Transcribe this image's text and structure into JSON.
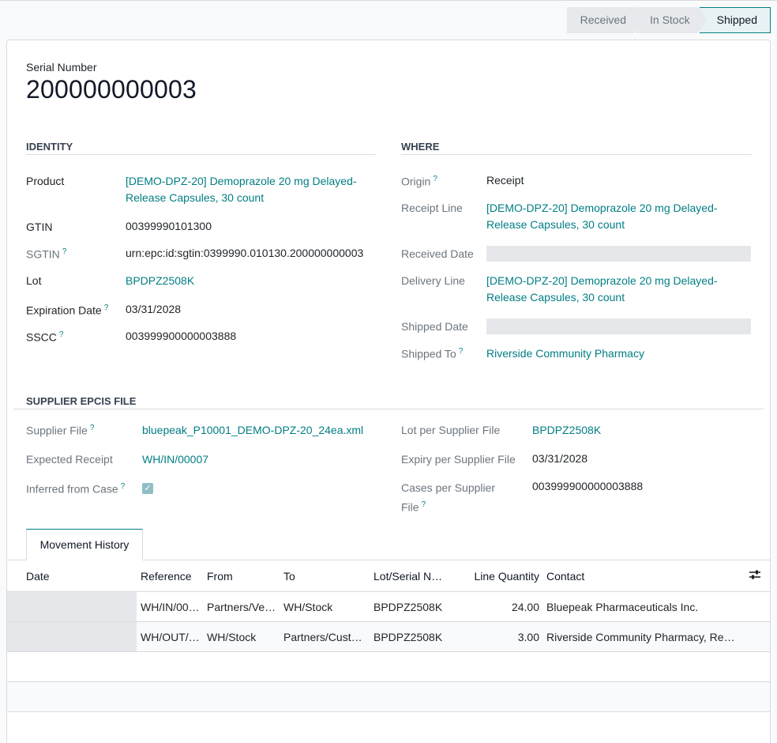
{
  "statusbar": {
    "stages": [
      {
        "label": "Received",
        "current": false
      },
      {
        "label": "In Stock",
        "current": false
      },
      {
        "label": "Shipped",
        "current": true
      }
    ]
  },
  "record": {
    "serial_label": "Serial Number",
    "serial_value": "200000000003"
  },
  "identity": {
    "heading": "IDENTITY",
    "product_label": "Product",
    "product_value_1": "[DEMO-DPZ-20] Demoprazole 20 mg Delayed-",
    "product_value_2": "Release Capsules, 30 count",
    "gtin_label": "GTIN",
    "gtin_value": "00399990101300",
    "sgtin_label": "SGTIN",
    "sgtin_value": "urn:epc:id:sgtin:0399990.010130.200000000003",
    "lot_label": "Lot",
    "lot_value": "BPDPZ2508K",
    "expiration_label": "Expiration Date",
    "expiration_value": "03/31/2028",
    "sscc_label": "SSCC",
    "sscc_value": "003999900000003888"
  },
  "where": {
    "heading": "WHERE",
    "origin_label": "Origin",
    "origin_value": "Receipt",
    "receipt_line_label": "Receipt Line",
    "receipt_line_value_1": "[DEMO-DPZ-20] Demoprazole 20 mg Delayed-",
    "receipt_line_value_2": "Release Capsules, 30 count",
    "received_date_label": "Received Date",
    "delivery_line_label": "Delivery Line",
    "delivery_line_value_1": "[DEMO-DPZ-20] Demoprazole 20 mg Delayed-",
    "delivery_line_value_2": "Release Capsules, 30 count",
    "shipped_date_label": "Shipped Date",
    "shipped_to_label": "Shipped To",
    "shipped_to_value": "Riverside Community Pharmacy"
  },
  "supplier": {
    "heading": "SUPPLIER EPCIS FILE",
    "file_label": "Supplier File",
    "file_value": "bluepeak_P10001_DEMO-DPZ-20_24ea.xml",
    "expected_label": "Expected Receipt",
    "expected_value": "WH/IN/00007",
    "inferred_label": "Inferred from Case",
    "lot_label": "Lot per Supplier File",
    "lot_value": "BPDPZ2508K",
    "expiry_label": "Expiry per Supplier File",
    "expiry_value": "03/31/2028",
    "cases_label_1": "Cases per Supplier",
    "cases_label_2": "File",
    "cases_value": "003999900000003888"
  },
  "tabs": {
    "movement_history": "Movement History"
  },
  "table": {
    "headers": {
      "date": "Date",
      "reference": "Reference",
      "from": "From",
      "to": "To",
      "lot": "Lot/Serial N…",
      "qty": "Line Quantity",
      "contact": "Contact"
    },
    "rows": [
      {
        "date": "",
        "reference": "WH/IN/00…",
        "from": "Partners/Ve…",
        "to": "WH/Stock",
        "lot": "BPDPZ2508K",
        "qty": "24.00",
        "contact": "Bluepeak Pharmaceuticals Inc."
      },
      {
        "date": "",
        "reference": "WH/OUT/…",
        "from": "WH/Stock",
        "to": "Partners/Cust…",
        "lot": "BPDPZ2508K",
        "qty": "3.00",
        "contact": "Riverside Community Pharmacy, Rec…"
      }
    ]
  },
  "help_marker": "?",
  "icons": {
    "checkbox": "check-icon",
    "column_options": "sliders-icon"
  }
}
